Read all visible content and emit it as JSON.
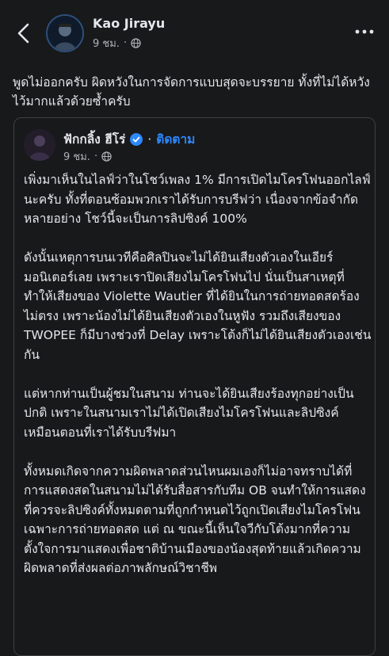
{
  "post": {
    "author": "Kao Jirayu",
    "time": "9 ชม.",
    "text": "พูดไม่ออกครับ ผิดหวังในการจัดการแบบสุดจะบรรยาย ทั้งที่ไม่ได้หวังไว้มากแล้วด้วยซ้ำครับ"
  },
  "shared": {
    "author": "ฟักกลิ้ง ฮีโร่",
    "follow": "ติดตาม",
    "time": "9 ชม.",
    "paragraphs": [
      "เพิ่งมาเห็นในไลฟ์ว่าในโชว์เพลง 1% มีการเปิดไมโครโฟนออกไลฟ์นะครับ ทั้งที่ตอนซ้อมพวกเราได้รับการบรีฟว่า เนื่องจากข้อจำกัดหลายอย่าง โชว์นี้จะเป็นการลิปซิงค์ 100%",
      "ดังนั้นเหตุการบนเวทีคือศิลปินจะไม่ได้ยินเสียงตัวเองในเอียร์มอนิเตอร์เลย เพราะเราปิดเสียงไมโครโฟนไป นั่นเป็นสาเหตุที่ทำให้เสียงของ Violette Wautier ที่ได้ยินในการถ่ายทอดสดร้องไม่ตรง เพราะน้องไม่ได้ยินเสียงตัวเองในหูฟัง รวมถึงเสียงของ TWOPEE ก็มีบางช่วงที่ Delay เพราะโต้งก็ไม่ได้ยินเสียงตัวเองเช่นกัน",
      "แต่หากท่านเป็นผู้ชมในสนาม ท่านจะได้ยินเสียงร้องทุกอย่างเป็นปกติ เพราะในสนามเราไม่ได้เปิดเสียงไมโครโฟนและลิปซิงค์เหมือนตอนที่เราได้รับบรีฟมา",
      "ทั้งหมดเกิดจากความผิดพลาดส่วนไหนผมเองก็ไม่อาจทราบได้ที่การแสดงสดในสนามไม่ได้รับสื่อสารกับทีม OB จนทำให้การแสดงที่ควรจะลิปซิงค์ทั้งหมดตามที่ถูกกำหนดไว้ถูกเปิดเสียงไมโครโฟนเฉพาะการถ่ายทอดสด แต่ ณ ขณะนี้เห็นใจวีกับโต้งมากที่ความตั้งใจการมาแสดงเพื่อชาติบ้านเมืองของน้องสุดท้ายแล้วเกิดความผิดพลาดที่ส่งผลต่อภาพลักษณ์วิชาชีพ"
    ]
  },
  "icons": {
    "back": "back-arrow-icon",
    "globe": "globe-icon",
    "more": "more-options-icon",
    "verified": "verified-badge-icon"
  },
  "colors": {
    "background": "#18191a",
    "text": "#e4e6eb",
    "secondary": "#b0b3b8",
    "link": "#2d88ff",
    "border": "#3e4042"
  }
}
